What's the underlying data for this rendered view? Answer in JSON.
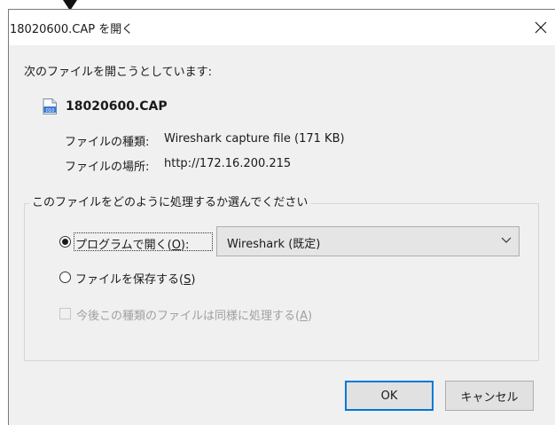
{
  "window": {
    "title": "18020600.CAP を開く",
    "close_glyph": "✕"
  },
  "intro": {
    "text": "次のファイルを開こうとしています:"
  },
  "file": {
    "icon": "capture-file-icon",
    "name": "18020600.CAP",
    "type_label": "ファイルの種類:",
    "type_value": "Wireshark capture file (171 KB)",
    "location_label": "ファイルの場所:",
    "location_value": "http://172.16.200.215"
  },
  "action_group": {
    "legend": "このファイルをどのように処理するか選んでください",
    "open_with": {
      "label_prefix": "プログラムで開く(",
      "accesskey": "O",
      "label_suffix": "):",
      "checked": true
    },
    "program_select": {
      "value": "Wireshark (既定)",
      "icon": "chevron-down-icon"
    },
    "save_file": {
      "label_prefix": "ファイルを保存する(",
      "accesskey": "S",
      "label_suffix": ")",
      "checked": false
    },
    "remember": {
      "label_prefix": "今後この種類のファイルは同様に処理する(",
      "accesskey": "A",
      "label_suffix": ")",
      "checked": false,
      "disabled": true
    }
  },
  "buttons": {
    "ok": "OK",
    "cancel": "キャンセル"
  },
  "colors": {
    "dialog_bg": "#f0f0f0",
    "titlebar_bg": "#ffffff",
    "default_button_border": "#0078d7"
  }
}
